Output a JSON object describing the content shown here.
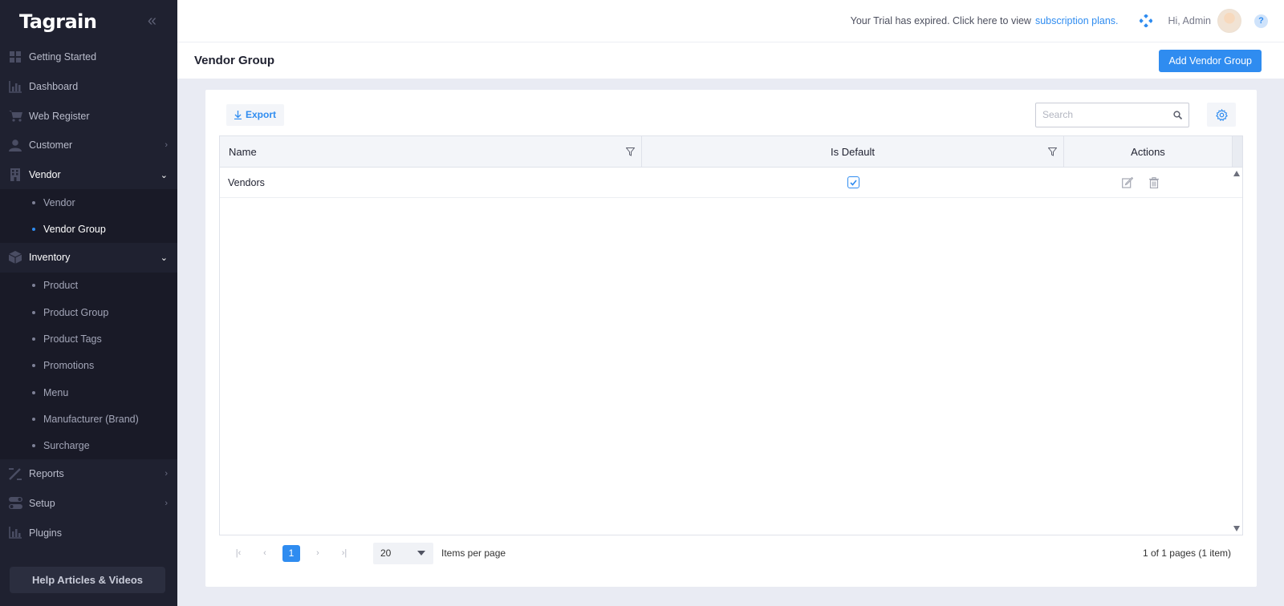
{
  "app": {
    "logo": "Tagrain"
  },
  "sidebar": {
    "items": [
      {
        "label": "Getting Started",
        "icon": "grid-icon"
      },
      {
        "label": "Dashboard",
        "icon": "bar-chart-icon"
      },
      {
        "label": "Web Register",
        "icon": "cart-icon"
      },
      {
        "label": "Customer",
        "icon": "user-icon"
      },
      {
        "label": "Vendor",
        "icon": "building-icon"
      },
      {
        "label": "Inventory",
        "icon": "box-icon"
      },
      {
        "label": "Reports",
        "icon": "pencil-ruler-icon"
      },
      {
        "label": "Setup",
        "icon": "toggle-icon"
      },
      {
        "label": "Plugins",
        "icon": "bar-chart-icon"
      }
    ],
    "vendor_sub": [
      "Vendor",
      "Vendor Group"
    ],
    "inventory_sub": [
      "Product",
      "Product Group",
      "Product Tags",
      "Promotions",
      "Menu",
      "Manufacturer (Brand)",
      "Surcharge"
    ],
    "help_label": "Help Articles & Videos"
  },
  "topbar": {
    "trial_text": "Your Trial has expired. Click here to view",
    "trial_link": "subscription plans.",
    "greeting": "Hi, Admin",
    "help_icon_label": "?"
  },
  "page": {
    "title": "Vendor Group",
    "add_button": "Add Vendor Group"
  },
  "toolbar": {
    "export_label": "Export",
    "search_placeholder": "Search"
  },
  "grid": {
    "columns": [
      "Name",
      "Is Default",
      "Actions"
    ],
    "rows": [
      {
        "name": "Vendors",
        "is_default": true
      }
    ]
  },
  "pager": {
    "current_page": "1",
    "page_size": "20",
    "items_per_page_label": "Items per page",
    "info": "1 of 1 pages (1 item)"
  },
  "colors": {
    "accent": "#2f8cf0",
    "sidebar_bg": "#1f2130",
    "page_bg": "#e9ebf3"
  }
}
